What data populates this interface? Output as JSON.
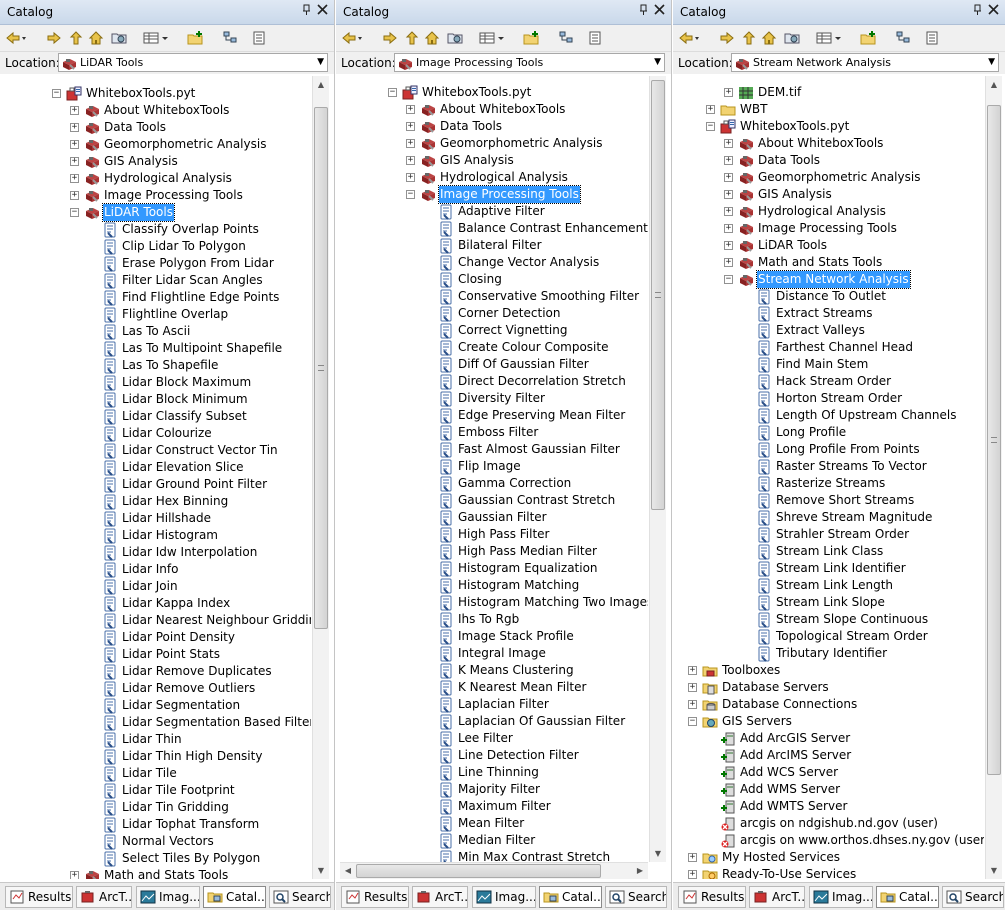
{
  "panels": [
    {
      "title": "Catalog",
      "location": "LiDAR Tools",
      "tabs": [
        "Results",
        "ArcT...",
        "Imag...",
        "Catal...",
        "Search"
      ],
      "active_tab": 3,
      "rows": [
        {
          "label": "WhiteboxTools.pyt",
          "icon": "toolbox-file-icon",
          "level": 0,
          "exp": "minus"
        },
        {
          "label": "About WhiteboxTools",
          "icon": "toolset-icon",
          "level": 1,
          "exp": "plus"
        },
        {
          "label": "Data Tools",
          "icon": "toolset-icon",
          "level": 1,
          "exp": "plus"
        },
        {
          "label": "Geomorphometric Analysis",
          "icon": "toolset-icon",
          "level": 1,
          "exp": "plus"
        },
        {
          "label": "GIS Analysis",
          "icon": "toolset-icon",
          "level": 1,
          "exp": "plus"
        },
        {
          "label": "Hydrological Analysis",
          "icon": "toolset-icon",
          "level": 1,
          "exp": "plus"
        },
        {
          "label": "Image Processing Tools",
          "icon": "toolset-icon",
          "level": 1,
          "exp": "plus"
        },
        {
          "label": "LiDAR Tools",
          "icon": "toolset-icon",
          "level": 1,
          "exp": "minus",
          "selected": true
        },
        {
          "label": "Classify Overlap Points",
          "icon": "script-tool-icon",
          "level": 2
        },
        {
          "label": "Clip Lidar To Polygon",
          "icon": "script-tool-icon",
          "level": 2
        },
        {
          "label": "Erase Polygon From Lidar",
          "icon": "script-tool-icon",
          "level": 2
        },
        {
          "label": "Filter Lidar Scan Angles",
          "icon": "script-tool-icon",
          "level": 2
        },
        {
          "label": "Find Flightline Edge Points",
          "icon": "script-tool-icon",
          "level": 2
        },
        {
          "label": "Flightline Overlap",
          "icon": "script-tool-icon",
          "level": 2
        },
        {
          "label": "Las To Ascii",
          "icon": "script-tool-icon",
          "level": 2
        },
        {
          "label": "Las To Multipoint Shapefile",
          "icon": "script-tool-icon",
          "level": 2
        },
        {
          "label": "Las To Shapefile",
          "icon": "script-tool-icon",
          "level": 2
        },
        {
          "label": "Lidar Block Maximum",
          "icon": "script-tool-icon",
          "level": 2
        },
        {
          "label": "Lidar Block Minimum",
          "icon": "script-tool-icon",
          "level": 2
        },
        {
          "label": "Lidar Classify Subset",
          "icon": "script-tool-icon",
          "level": 2
        },
        {
          "label": "Lidar Colourize",
          "icon": "script-tool-icon",
          "level": 2
        },
        {
          "label": "Lidar Construct Vector Tin",
          "icon": "script-tool-icon",
          "level": 2
        },
        {
          "label": "Lidar Elevation Slice",
          "icon": "script-tool-icon",
          "level": 2
        },
        {
          "label": "Lidar Ground Point Filter",
          "icon": "script-tool-icon",
          "level": 2
        },
        {
          "label": "Lidar Hex Binning",
          "icon": "script-tool-icon",
          "level": 2
        },
        {
          "label": "Lidar Hillshade",
          "icon": "script-tool-icon",
          "level": 2
        },
        {
          "label": "Lidar Histogram",
          "icon": "script-tool-icon",
          "level": 2
        },
        {
          "label": "Lidar Idw Interpolation",
          "icon": "script-tool-icon",
          "level": 2
        },
        {
          "label": "Lidar Info",
          "icon": "script-tool-icon",
          "level": 2
        },
        {
          "label": "Lidar Join",
          "icon": "script-tool-icon",
          "level": 2
        },
        {
          "label": "Lidar Kappa Index",
          "icon": "script-tool-icon",
          "level": 2
        },
        {
          "label": "Lidar Nearest Neighbour Gridding",
          "icon": "script-tool-icon",
          "level": 2
        },
        {
          "label": "Lidar Point Density",
          "icon": "script-tool-icon",
          "level": 2
        },
        {
          "label": "Lidar Point Stats",
          "icon": "script-tool-icon",
          "level": 2
        },
        {
          "label": "Lidar Remove Duplicates",
          "icon": "script-tool-icon",
          "level": 2
        },
        {
          "label": "Lidar Remove Outliers",
          "icon": "script-tool-icon",
          "level": 2
        },
        {
          "label": "Lidar Segmentation",
          "icon": "script-tool-icon",
          "level": 2
        },
        {
          "label": "Lidar Segmentation Based Filter",
          "icon": "script-tool-icon",
          "level": 2
        },
        {
          "label": "Lidar Thin",
          "icon": "script-tool-icon",
          "level": 2
        },
        {
          "label": "Lidar Thin High Density",
          "icon": "script-tool-icon",
          "level": 2
        },
        {
          "label": "Lidar Tile",
          "icon": "script-tool-icon",
          "level": 2
        },
        {
          "label": "Lidar Tile Footprint",
          "icon": "script-tool-icon",
          "level": 2
        },
        {
          "label": "Lidar Tin Gridding",
          "icon": "script-tool-icon",
          "level": 2
        },
        {
          "label": "Lidar Tophat Transform",
          "icon": "script-tool-icon",
          "level": 2
        },
        {
          "label": "Normal Vectors",
          "icon": "script-tool-icon",
          "level": 2
        },
        {
          "label": "Select Tiles By Polygon",
          "icon": "script-tool-icon",
          "level": 2
        },
        {
          "label": "Math and Stats Tools",
          "icon": "toolset-icon",
          "level": 1,
          "exp": "plus"
        }
      ]
    },
    {
      "title": "Catalog",
      "location": "Image Processing Tools",
      "tabs": [
        "Results",
        "ArcT...",
        "Imag...",
        "Catal...",
        "Search"
      ],
      "active_tab": 3,
      "rows": [
        {
          "label": "WhiteboxTools.pyt",
          "icon": "toolbox-file-icon",
          "level": 0,
          "exp": "minus"
        },
        {
          "label": "About WhiteboxTools",
          "icon": "toolset-icon",
          "level": 1,
          "exp": "plus"
        },
        {
          "label": "Data Tools",
          "icon": "toolset-icon",
          "level": 1,
          "exp": "plus"
        },
        {
          "label": "Geomorphometric Analysis",
          "icon": "toolset-icon",
          "level": 1,
          "exp": "plus"
        },
        {
          "label": "GIS Analysis",
          "icon": "toolset-icon",
          "level": 1,
          "exp": "plus"
        },
        {
          "label": "Hydrological Analysis",
          "icon": "toolset-icon",
          "level": 1,
          "exp": "plus"
        },
        {
          "label": "Image Processing Tools",
          "icon": "toolset-icon",
          "level": 1,
          "exp": "minus",
          "selected": true
        },
        {
          "label": "Adaptive Filter",
          "icon": "script-tool-icon",
          "level": 2
        },
        {
          "label": "Balance Contrast Enhancement",
          "icon": "script-tool-icon",
          "level": 2
        },
        {
          "label": "Bilateral Filter",
          "icon": "script-tool-icon",
          "level": 2
        },
        {
          "label": "Change Vector Analysis",
          "icon": "script-tool-icon",
          "level": 2
        },
        {
          "label": "Closing",
          "icon": "script-tool-icon",
          "level": 2
        },
        {
          "label": "Conservative Smoothing Filter",
          "icon": "script-tool-icon",
          "level": 2
        },
        {
          "label": "Corner Detection",
          "icon": "script-tool-icon",
          "level": 2
        },
        {
          "label": "Correct Vignetting",
          "icon": "script-tool-icon",
          "level": 2
        },
        {
          "label": "Create Colour Composite",
          "icon": "script-tool-icon",
          "level": 2
        },
        {
          "label": "Diff Of Gaussian Filter",
          "icon": "script-tool-icon",
          "level": 2
        },
        {
          "label": "Direct Decorrelation Stretch",
          "icon": "script-tool-icon",
          "level": 2
        },
        {
          "label": "Diversity Filter",
          "icon": "script-tool-icon",
          "level": 2
        },
        {
          "label": "Edge Preserving Mean Filter",
          "icon": "script-tool-icon",
          "level": 2
        },
        {
          "label": "Emboss Filter",
          "icon": "script-tool-icon",
          "level": 2
        },
        {
          "label": "Fast Almost Gaussian Filter",
          "icon": "script-tool-icon",
          "level": 2
        },
        {
          "label": "Flip Image",
          "icon": "script-tool-icon",
          "level": 2
        },
        {
          "label": "Gamma Correction",
          "icon": "script-tool-icon",
          "level": 2
        },
        {
          "label": "Gaussian Contrast Stretch",
          "icon": "script-tool-icon",
          "level": 2
        },
        {
          "label": "Gaussian Filter",
          "icon": "script-tool-icon",
          "level": 2
        },
        {
          "label": "High Pass Filter",
          "icon": "script-tool-icon",
          "level": 2
        },
        {
          "label": "High Pass Median Filter",
          "icon": "script-tool-icon",
          "level": 2
        },
        {
          "label": "Histogram Equalization",
          "icon": "script-tool-icon",
          "level": 2
        },
        {
          "label": "Histogram Matching",
          "icon": "script-tool-icon",
          "level": 2
        },
        {
          "label": "Histogram Matching Two Images",
          "icon": "script-tool-icon",
          "level": 2
        },
        {
          "label": "Ihs To Rgb",
          "icon": "script-tool-icon",
          "level": 2
        },
        {
          "label": "Image Stack Profile",
          "icon": "script-tool-icon",
          "level": 2
        },
        {
          "label": "Integral Image",
          "icon": "script-tool-icon",
          "level": 2
        },
        {
          "label": "K Means Clustering",
          "icon": "script-tool-icon",
          "level": 2
        },
        {
          "label": "K Nearest Mean Filter",
          "icon": "script-tool-icon",
          "level": 2
        },
        {
          "label": "Laplacian Filter",
          "icon": "script-tool-icon",
          "level": 2
        },
        {
          "label": "Laplacian Of Gaussian Filter",
          "icon": "script-tool-icon",
          "level": 2
        },
        {
          "label": "Lee Filter",
          "icon": "script-tool-icon",
          "level": 2
        },
        {
          "label": "Line Detection Filter",
          "icon": "script-tool-icon",
          "level": 2
        },
        {
          "label": "Line Thinning",
          "icon": "script-tool-icon",
          "level": 2
        },
        {
          "label": "Majority Filter",
          "icon": "script-tool-icon",
          "level": 2
        },
        {
          "label": "Maximum Filter",
          "icon": "script-tool-icon",
          "level": 2
        },
        {
          "label": "Mean Filter",
          "icon": "script-tool-icon",
          "level": 2
        },
        {
          "label": "Median Filter",
          "icon": "script-tool-icon",
          "level": 2
        },
        {
          "label": "Min Max Contrast Stretch",
          "icon": "script-tool-icon",
          "level": 2
        }
      ]
    },
    {
      "title": "Catalog",
      "location": "Stream Network Analysis",
      "tabs": [
        "Results",
        "ArcT...",
        "Imag...",
        "Catal...",
        "Search"
      ],
      "active_tab": 3,
      "rows": [
        {
          "label": "DEM.tif",
          "icon": "raster-icon",
          "level": 2,
          "exp": "plus"
        },
        {
          "label": "WBT",
          "icon": "folder-icon",
          "level": 1,
          "exp": "plus"
        },
        {
          "label": "WhiteboxTools.pyt",
          "icon": "toolbox-file-icon",
          "level": 1,
          "exp": "minus"
        },
        {
          "label": "About WhiteboxTools",
          "icon": "toolset-icon",
          "level": 2,
          "exp": "plus"
        },
        {
          "label": "Data Tools",
          "icon": "toolset-icon",
          "level": 2,
          "exp": "plus"
        },
        {
          "label": "Geomorphometric Analysis",
          "icon": "toolset-icon",
          "level": 2,
          "exp": "plus"
        },
        {
          "label": "GIS Analysis",
          "icon": "toolset-icon",
          "level": 2,
          "exp": "plus"
        },
        {
          "label": "Hydrological Analysis",
          "icon": "toolset-icon",
          "level": 2,
          "exp": "plus"
        },
        {
          "label": "Image Processing Tools",
          "icon": "toolset-icon",
          "level": 2,
          "exp": "plus"
        },
        {
          "label": "LiDAR Tools",
          "icon": "toolset-icon",
          "level": 2,
          "exp": "plus"
        },
        {
          "label": "Math and Stats Tools",
          "icon": "toolset-icon",
          "level": 2,
          "exp": "plus"
        },
        {
          "label": "Stream Network Analysis",
          "icon": "toolset-icon",
          "level": 2,
          "exp": "minus",
          "selected": true
        },
        {
          "label": "Distance To Outlet",
          "icon": "script-tool-icon",
          "level": 3
        },
        {
          "label": "Extract Streams",
          "icon": "script-tool-icon",
          "level": 3
        },
        {
          "label": "Extract Valleys",
          "icon": "script-tool-icon",
          "level": 3
        },
        {
          "label": "Farthest Channel Head",
          "icon": "script-tool-icon",
          "level": 3
        },
        {
          "label": "Find Main Stem",
          "icon": "script-tool-icon",
          "level": 3
        },
        {
          "label": "Hack Stream Order",
          "icon": "script-tool-icon",
          "level": 3
        },
        {
          "label": "Horton Stream Order",
          "icon": "script-tool-icon",
          "level": 3
        },
        {
          "label": "Length Of Upstream Channels",
          "icon": "script-tool-icon",
          "level": 3
        },
        {
          "label": "Long Profile",
          "icon": "script-tool-icon",
          "level": 3
        },
        {
          "label": "Long Profile From Points",
          "icon": "script-tool-icon",
          "level": 3
        },
        {
          "label": "Raster Streams To Vector",
          "icon": "script-tool-icon",
          "level": 3
        },
        {
          "label": "Rasterize Streams",
          "icon": "script-tool-icon",
          "level": 3
        },
        {
          "label": "Remove Short Streams",
          "icon": "script-tool-icon",
          "level": 3
        },
        {
          "label": "Shreve Stream Magnitude",
          "icon": "script-tool-icon",
          "level": 3
        },
        {
          "label": "Strahler Stream Order",
          "icon": "script-tool-icon",
          "level": 3
        },
        {
          "label": "Stream Link Class",
          "icon": "script-tool-icon",
          "level": 3
        },
        {
          "label": "Stream Link Identifier",
          "icon": "script-tool-icon",
          "level": 3
        },
        {
          "label": "Stream Link Length",
          "icon": "script-tool-icon",
          "level": 3
        },
        {
          "label": "Stream Link Slope",
          "icon": "script-tool-icon",
          "level": 3
        },
        {
          "label": "Stream Slope Continuous",
          "icon": "script-tool-icon",
          "level": 3
        },
        {
          "label": "Topological Stream Order",
          "icon": "script-tool-icon",
          "level": 3
        },
        {
          "label": "Tributary Identifier",
          "icon": "script-tool-icon",
          "level": 3
        },
        {
          "label": "Toolboxes",
          "icon": "toolboxes-icon",
          "level": 0,
          "exp": "plus"
        },
        {
          "label": "Database Servers",
          "icon": "database-servers-icon",
          "level": 0,
          "exp": "plus"
        },
        {
          "label": "Database Connections",
          "icon": "database-connections-icon",
          "level": 0,
          "exp": "plus"
        },
        {
          "label": "GIS Servers",
          "icon": "gis-servers-icon",
          "level": 0,
          "exp": "minus"
        },
        {
          "label": "Add ArcGIS Server",
          "icon": "add-server-icon",
          "level": 1
        },
        {
          "label": "Add ArcIMS Server",
          "icon": "add-server-icon",
          "level": 1
        },
        {
          "label": "Add WCS Server",
          "icon": "add-server-icon",
          "level": 1
        },
        {
          "label": "Add WMS Server",
          "icon": "add-server-icon",
          "level": 1
        },
        {
          "label": "Add WMTS Server",
          "icon": "add-server-icon",
          "level": 1
        },
        {
          "label": "arcgis on ndgishub.nd.gov (user)",
          "icon": "server-connection-icon",
          "level": 1
        },
        {
          "label": "arcgis on www.orthos.dhses.ny.gov (user)",
          "icon": "server-connection-icon",
          "level": 1
        },
        {
          "label": "My Hosted Services",
          "icon": "hosted-services-icon",
          "level": 0,
          "exp": "plus"
        },
        {
          "label": "Ready-To-Use Services",
          "icon": "ready-services-icon",
          "level": 0,
          "exp": "plus"
        }
      ]
    }
  ],
  "location_label": "Location:",
  "toolbar_icons": [
    "back-arrow-icon",
    "forward-arrow-icon",
    "up-folder-icon",
    "home-icon",
    "catalog-folder-icon",
    "view-menu-icon",
    "connect-folder-icon",
    "toggle-tree-icon",
    "options-icon"
  ],
  "colors": {
    "selection": "#3399ff",
    "title_bar": "#d4e0ef"
  }
}
